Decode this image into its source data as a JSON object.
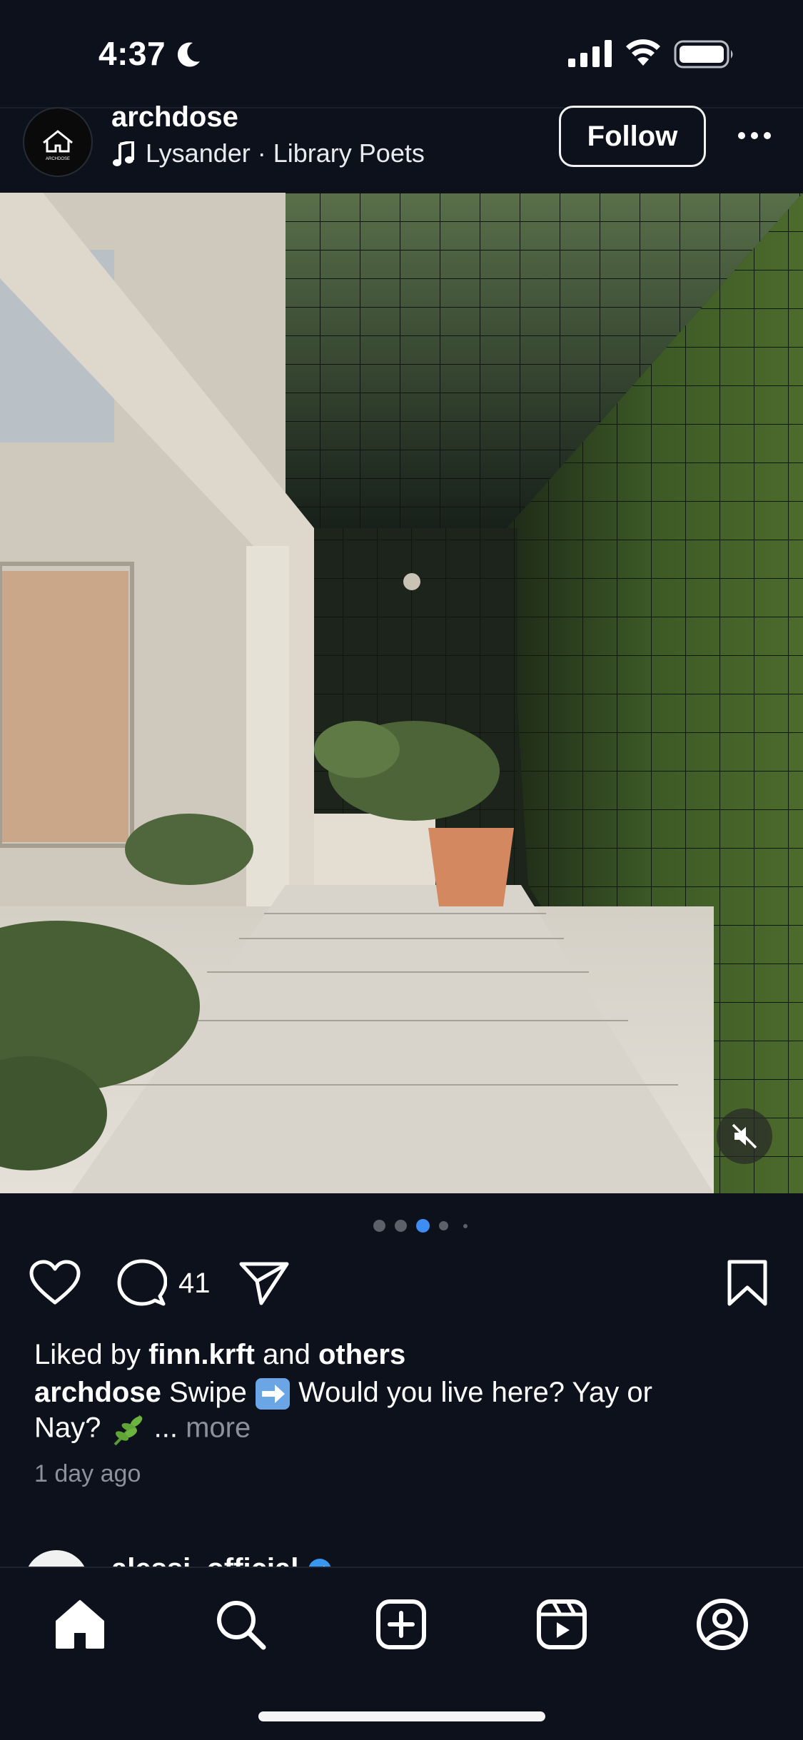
{
  "status_bar": {
    "time": "4:37"
  },
  "post": {
    "username": "archdose",
    "avatar_logo_text": "ARCHDOSE",
    "audio": "Lysander · Library Poets",
    "follow_label": "Follow",
    "carousel": {
      "count": 5,
      "active_index": 2
    },
    "comment_count": "41",
    "likes": {
      "prefix": "Liked by ",
      "user": "finn.krft",
      "middle": " and ",
      "others": "others"
    },
    "caption": {
      "username": "archdose",
      "text_before_emoji": " Swipe ",
      "text_after_emoji": " Would you live here? Yay or",
      "line2_text": "Nay? ",
      "line2_after_emoji": " ... ",
      "more_label": "more"
    },
    "timestamp": "1 day ago"
  },
  "next_post": {
    "username": "alessi_official"
  },
  "tab_bar": {
    "items": [
      "home",
      "search",
      "create",
      "reels",
      "profile"
    ]
  },
  "colors": {
    "background": "#0c111b",
    "active_dot": "#3d8df5",
    "inactive_dot": "#5b6069",
    "verified": "#3897f0",
    "muted_text": "#8b919b"
  }
}
